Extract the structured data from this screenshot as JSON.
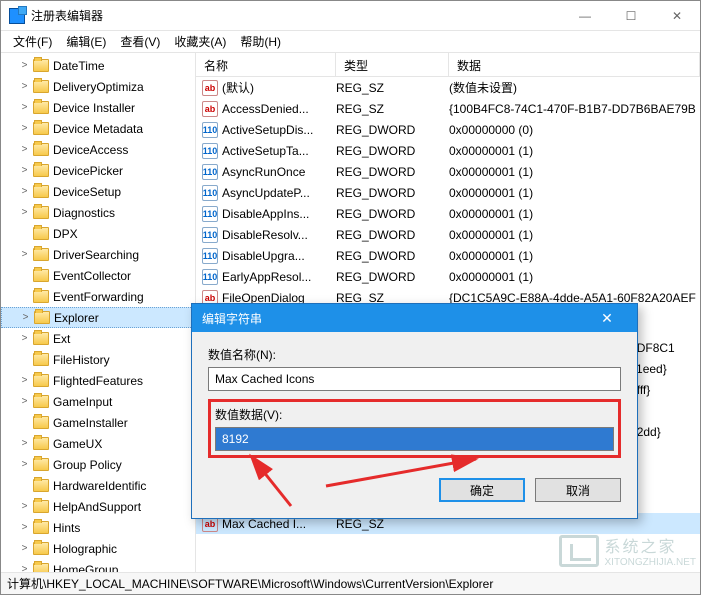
{
  "window": {
    "title": "注册表编辑器",
    "controls": {
      "min": "—",
      "max": "☐",
      "close": "✕"
    }
  },
  "menu": {
    "file": "文件(F)",
    "edit": "编辑(E)",
    "view": "查看(V)",
    "fav": "收藏夹(A)",
    "help": "帮助(H)"
  },
  "tree": [
    {
      "label": "DateTime",
      "exp": ">"
    },
    {
      "label": "DeliveryOptimiza",
      "exp": ">"
    },
    {
      "label": "Device Installer",
      "exp": ">"
    },
    {
      "label": "Device Metadata",
      "exp": ">"
    },
    {
      "label": "DeviceAccess",
      "exp": ">"
    },
    {
      "label": "DevicePicker",
      "exp": ">"
    },
    {
      "label": "DeviceSetup",
      "exp": ">"
    },
    {
      "label": "Diagnostics",
      "exp": ">"
    },
    {
      "label": "DPX",
      "exp": ""
    },
    {
      "label": "DriverSearching",
      "exp": ">"
    },
    {
      "label": "EventCollector",
      "exp": ""
    },
    {
      "label": "EventForwarding",
      "exp": ""
    },
    {
      "label": "Explorer",
      "exp": ">",
      "sel": true
    },
    {
      "label": "Ext",
      "exp": ">"
    },
    {
      "label": "FileHistory",
      "exp": ""
    },
    {
      "label": "FlightedFeatures",
      "exp": ">"
    },
    {
      "label": "GameInput",
      "exp": ">"
    },
    {
      "label": "GameInstaller",
      "exp": ""
    },
    {
      "label": "GameUX",
      "exp": ">"
    },
    {
      "label": "Group Policy",
      "exp": ">"
    },
    {
      "label": "HardwareIdentific",
      "exp": ""
    },
    {
      "label": "HelpAndSupport",
      "exp": ">"
    },
    {
      "label": "Hints",
      "exp": ">"
    },
    {
      "label": "Holographic",
      "exp": ">"
    },
    {
      "label": "HomeGroup",
      "exp": ">"
    }
  ],
  "list": {
    "headers": {
      "name": "名称",
      "type": "类型",
      "data": "数据"
    },
    "rows": [
      {
        "icon": "sz",
        "name": "(默认)",
        "type": "REG_SZ",
        "data": "(数值未设置)"
      },
      {
        "icon": "sz",
        "name": "AccessDenied...",
        "type": "REG_SZ",
        "data": "{100B4FC8-74C1-470F-B1B7-DD7B6BAE79B"
      },
      {
        "icon": "dw",
        "name": "ActiveSetupDis...",
        "type": "REG_DWORD",
        "data": "0x00000000 (0)"
      },
      {
        "icon": "dw",
        "name": "ActiveSetupTa...",
        "type": "REG_DWORD",
        "data": "0x00000001 (1)"
      },
      {
        "icon": "dw",
        "name": "AsyncRunOnce",
        "type": "REG_DWORD",
        "data": "0x00000001 (1)"
      },
      {
        "icon": "dw",
        "name": "AsyncUpdateP...",
        "type": "REG_DWORD",
        "data": "0x00000001 (1)"
      },
      {
        "icon": "dw",
        "name": "DisableAppIns...",
        "type": "REG_DWORD",
        "data": "0x00000001 (1)"
      },
      {
        "icon": "dw",
        "name": "DisableResolv...",
        "type": "REG_DWORD",
        "data": "0x00000001 (1)"
      },
      {
        "icon": "dw",
        "name": "DisableUpgra...",
        "type": "REG_DWORD",
        "data": "0x00000001 (1)"
      },
      {
        "icon": "dw",
        "name": "EarlyAppResol...",
        "type": "REG_DWORD",
        "data": "0x00000001 (1)"
      },
      {
        "icon": "sz",
        "name": "FileOpenDialog",
        "type": "REG_SZ",
        "data": "{DC1C5A9C-E88A-4dde-A5A1-60F82A20AEF"
      }
    ],
    "partial": [
      {
        "data": "5097DF8C1"
      },
      {
        "data": "91ca1eed}"
      },
      {
        "data": "5e37fff}"
      },
      {
        "data": ""
      },
      {
        "data": "64572dd}"
      }
    ],
    "last_row": {
      "icon": "sz",
      "name": "Max Cached I...",
      "type": "REG_SZ",
      "data": "",
      "sel": true
    }
  },
  "dialog": {
    "title": "编辑字符串",
    "name_label": "数值名称(N):",
    "name_value": "Max Cached Icons",
    "data_label": "数值数据(V):",
    "data_value": "8192",
    "ok": "确定",
    "cancel": "取消"
  },
  "status": {
    "path": "计算机\\HKEY_LOCAL_MACHINE\\SOFTWARE\\Microsoft\\Windows\\CurrentVersion\\Explorer"
  },
  "watermark": "系统之家"
}
